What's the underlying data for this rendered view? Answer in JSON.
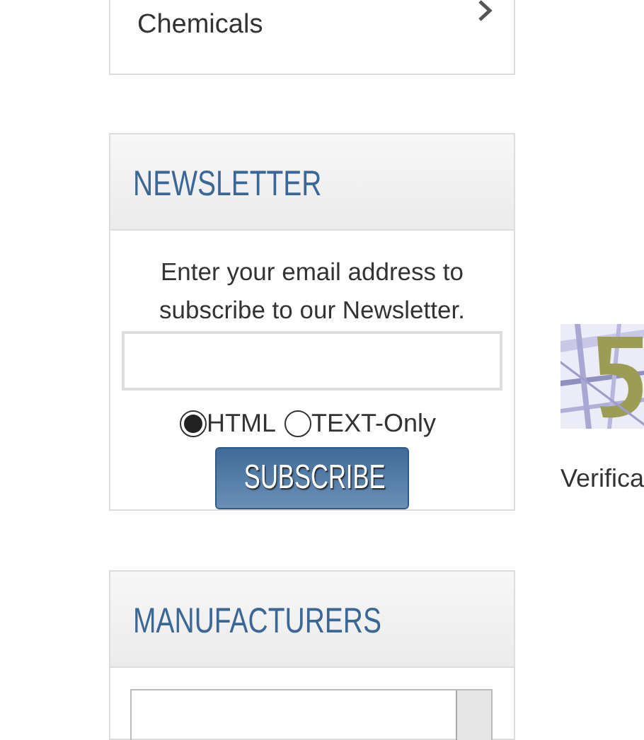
{
  "category_card": {
    "label": "Chemicals"
  },
  "newsletter": {
    "title": "NEWSLETTER",
    "prompt": "Enter your email address to subscribe to our Newsletter.",
    "format_options": [
      {
        "label": "HTML",
        "selected": true
      },
      {
        "label": "TEXT-Only",
        "selected": false
      }
    ],
    "button": "SUBSCRIBE"
  },
  "manufacturers": {
    "title": "MANUFACTURERS"
  },
  "verification": {
    "label": "Verifica"
  }
}
